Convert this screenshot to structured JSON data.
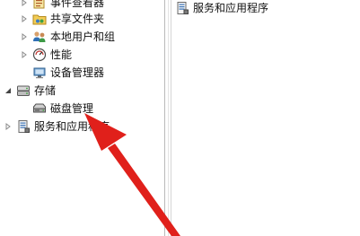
{
  "tree": {
    "items": [
      {
        "label": "事件查看器",
        "icon": "event-viewer-icon",
        "expander": "collapsed"
      },
      {
        "label": "共享文件夹",
        "icon": "shared-folders-icon",
        "expander": "collapsed"
      },
      {
        "label": "本地用户和组",
        "icon": "local-users-groups-icon",
        "expander": "collapsed"
      },
      {
        "label": "性能",
        "icon": "performance-icon",
        "expander": "collapsed"
      },
      {
        "label": "设备管理器",
        "icon": "device-manager-icon",
        "expander": "none"
      },
      {
        "label": "存储",
        "icon": "storage-icon",
        "expander": "expanded"
      },
      {
        "label": "磁盘管理",
        "icon": "disk-management-icon",
        "expander": "none",
        "selected": true
      },
      {
        "label": "服务和应用程序",
        "icon": "services-applications-icon",
        "expander": "collapsed"
      }
    ]
  },
  "right_pane": {
    "items": [
      {
        "label": "服务和应用程序",
        "icon": "services-applications-icon"
      }
    ]
  },
  "colors": {
    "annotation_arrow": "#e0201b",
    "selection": "#e5f1fb"
  }
}
